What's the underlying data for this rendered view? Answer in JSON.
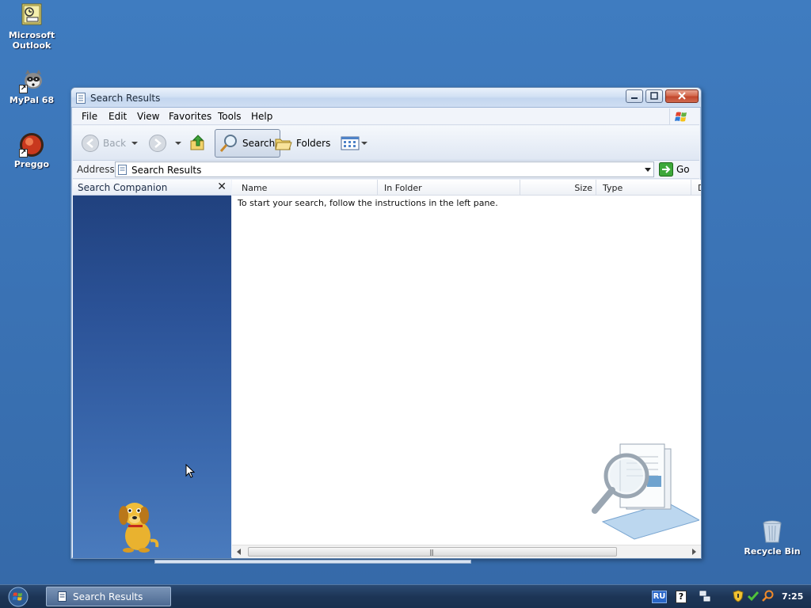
{
  "desktop": {
    "icons": [
      {
        "label_line1": "Microsoft",
        "label_line2": "Outlook"
      },
      {
        "label_line1": "MyPal 68",
        "label_line2": ""
      },
      {
        "label_line1": "Preggo",
        "label_line2": ""
      },
      {
        "label_line1": "Recycle Bin",
        "label_line2": ""
      }
    ]
  },
  "window": {
    "title": "Search Results",
    "menu": [
      "File",
      "Edit",
      "View",
      "Favorites",
      "Tools",
      "Help"
    ],
    "toolbar": {
      "back_label": "Back",
      "search_label": "Search",
      "folders_label": "Folders"
    },
    "address": {
      "label": "Address",
      "value": "Search Results",
      "go_label": "Go"
    },
    "companion": {
      "title": "Search Companion",
      "close_glyph": "✕"
    },
    "columns": [
      "Name",
      "In Folder",
      "Size",
      "Type",
      "D"
    ],
    "empty_message": "To start your search, follow the instructions in the left pane."
  },
  "taskbar": {
    "task_label": "Search Results",
    "language": "RU",
    "help_glyph": "?",
    "clock": "7:25"
  },
  "colors": {
    "desktop": "#3a72b4",
    "taskbar": "#1d3556",
    "companion": "#2b5297"
  }
}
